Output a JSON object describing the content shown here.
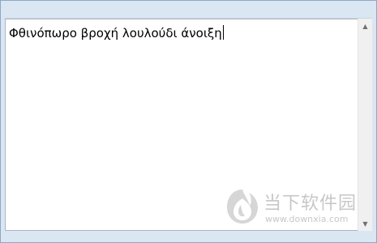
{
  "editor": {
    "text": "Φθινόπωρο βροχή λουλούδι άνοιξη"
  },
  "scrollbar": {
    "up_arrow": "▲",
    "down_arrow": "▼"
  },
  "watermark": {
    "brand": "当下软件园",
    "url": "www.downxia.com"
  }
}
